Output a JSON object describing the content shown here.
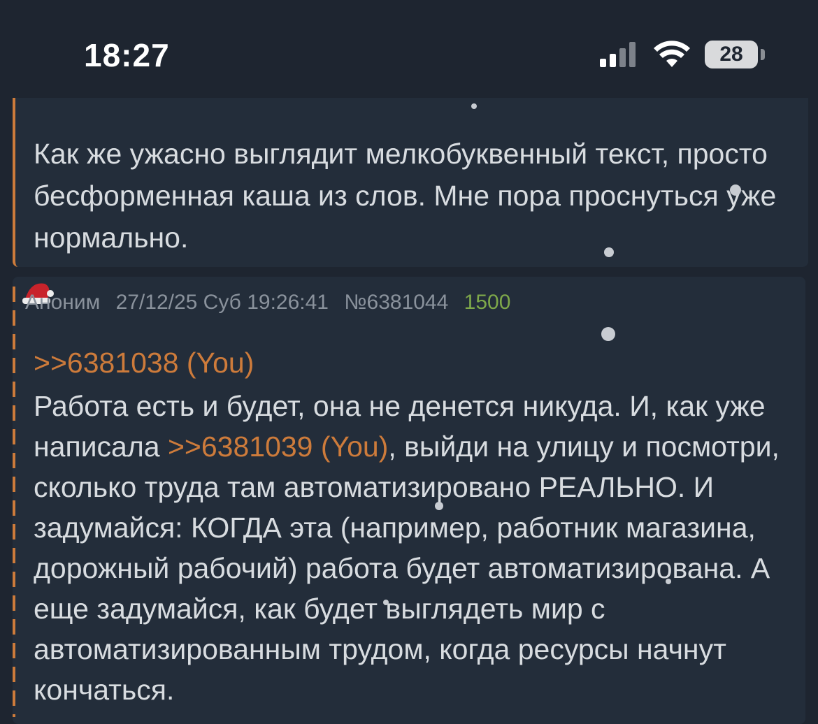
{
  "status_bar": {
    "time": "18:27",
    "battery": "28"
  },
  "post1": {
    "text": "Как же ужасно выглядит мелкобуквенный текст, просто бесформенная каша из слов. Мне пора проснуться уже нормально."
  },
  "post2": {
    "author": "Аноним",
    "date": "27/12/25 Суб 19:26:41",
    "number": "№6381044",
    "score": "1500",
    "reply_link": ">>6381038 (You)",
    "text_before": "Работа есть и будет, она не денется никуда. И, как уже написала ",
    "inline_link": ">>6381039 (You)",
    "text_after": ", выйди на улицу и посмотри, сколько труда там автоматизировано РЕАЛЬНО. И задумайся: КОГДА эта (например, работник магазина, дорожный рабочий) работа будет автоматизирована. А еще задумайся, как будет выглядеть мир с автоматизированным трудом, когда ресурсы начнут кончаться."
  },
  "icons": {
    "signal": "cellular-signal-icon",
    "wifi": "wifi-icon",
    "battery": "battery-icon",
    "santa_hat": "santa-hat-icon"
  },
  "colors": {
    "background": "#1e2530",
    "post_bg": "#232d3a",
    "link": "#cd7b3b",
    "score": "#7ea84a"
  }
}
